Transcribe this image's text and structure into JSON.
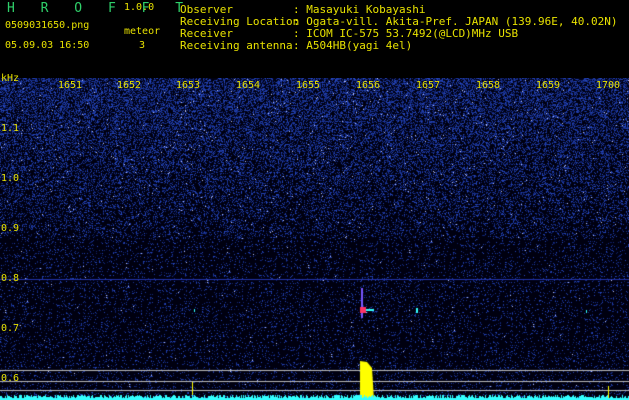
{
  "app": {
    "name": "H R O F F T",
    "version": "1.0.0"
  },
  "file": {
    "name": "0509031650.png",
    "timestamp": "05.09.03 16:50"
  },
  "meteor": {
    "label": "meteor",
    "count": "3"
  },
  "info": [
    {
      "key": "Observer",
      "value": ": Masayuki Kobayashi"
    },
    {
      "key": "Receiving Location",
      "value": ": Ogata-vill. Akita-Pref. JAPAN (139.96E, 40.02N)"
    },
    {
      "key": "Receiver",
      "value": ": ICOM IC-575 53.7492(@LCD)MHz USB"
    },
    {
      "key": "Receiving antenna",
      "value": ": A504HB(yagi 4el)"
    }
  ],
  "axis": {
    "y_unit": "kHz",
    "y_ticks": [
      "1.1",
      "1.0",
      "0.9",
      "0.8",
      "0.7",
      "0.6"
    ],
    "x_ticks": [
      "1651",
      "1652",
      "1653",
      "1654",
      "1655",
      "1656",
      "1657",
      "1658",
      "1659",
      "1700"
    ]
  },
  "colors": {
    "text": "#e8e200",
    "title": "#2fd06a",
    "background_noise": "#1a2a9a",
    "echo": "#ffff00",
    "signal_trace": "#33ffff"
  }
}
